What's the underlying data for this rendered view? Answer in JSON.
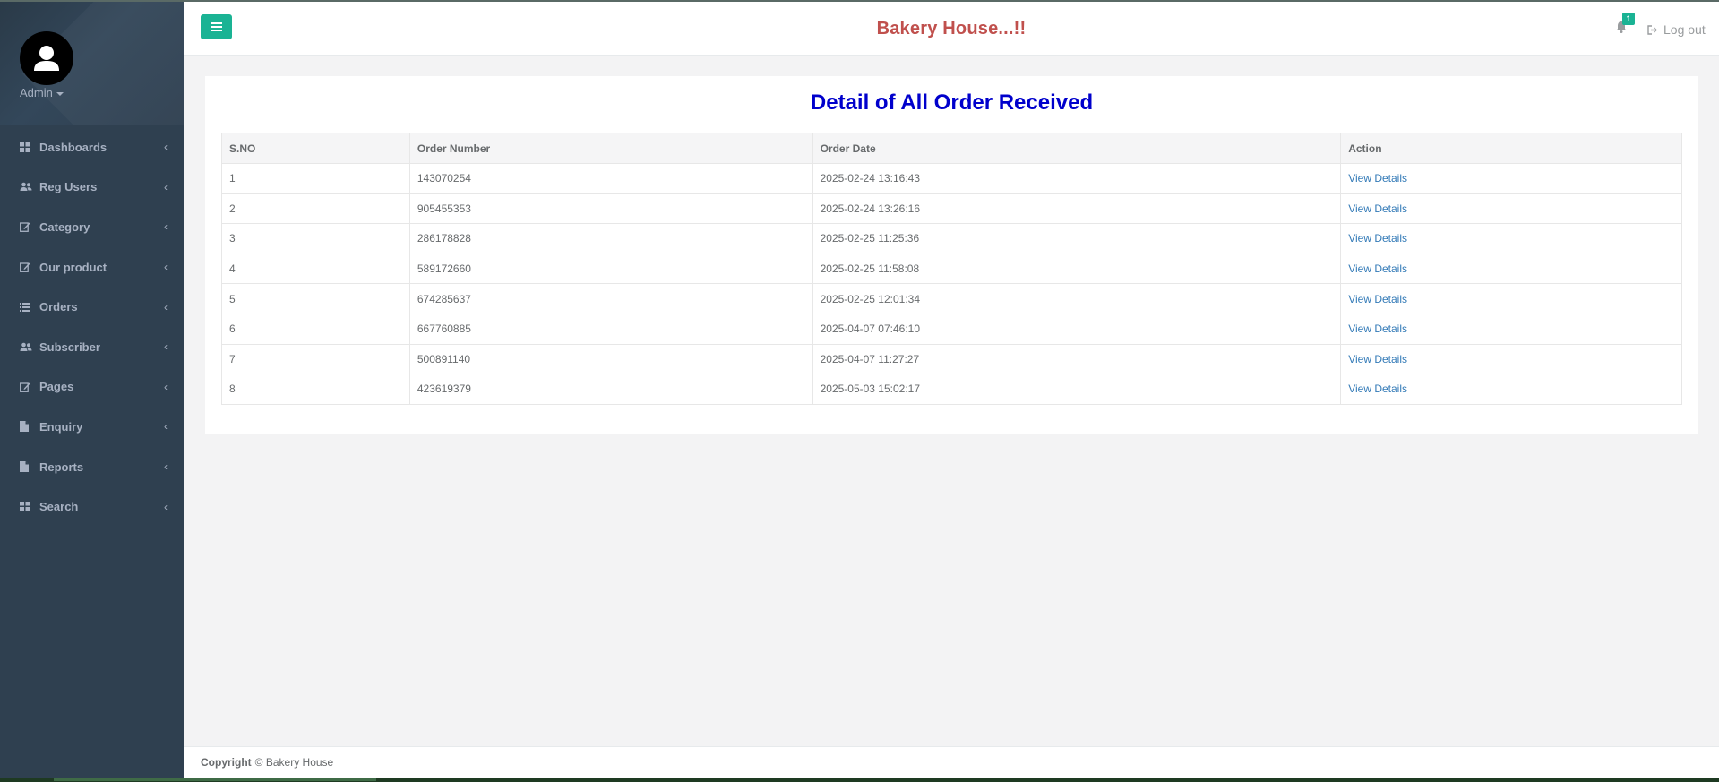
{
  "sidebar": {
    "profile": {
      "name": "Admin"
    },
    "items": [
      {
        "label": "Dashboards",
        "icon": "th-large-icon"
      },
      {
        "label": "Reg Users",
        "icon": "users-icon"
      },
      {
        "label": "Category",
        "icon": "edit-icon"
      },
      {
        "label": "Our product",
        "icon": "edit-icon"
      },
      {
        "label": "Orders",
        "icon": "list-icon"
      },
      {
        "label": "Subscriber",
        "icon": "users-icon"
      },
      {
        "label": "Pages",
        "icon": "edit-icon"
      },
      {
        "label": "Enquiry",
        "icon": "file-icon"
      },
      {
        "label": "Reports",
        "icon": "file-icon"
      },
      {
        "label": "Search",
        "icon": "th-large-icon"
      }
    ]
  },
  "header": {
    "brand": "Bakery House...!!",
    "notification_count": "1",
    "logout_label": "Log out"
  },
  "main": {
    "title": "Detail of All Order Received",
    "columns": [
      "S.NO",
      "Order Number",
      "Order Date",
      "Action"
    ],
    "rows": [
      {
        "sno": "1",
        "order_number": "143070254",
        "order_date": "2025-02-24 13:16:43",
        "action": "View Details"
      },
      {
        "sno": "2",
        "order_number": "905455353",
        "order_date": "2025-02-24 13:26:16",
        "action": "View Details"
      },
      {
        "sno": "3",
        "order_number": "286178828",
        "order_date": "2025-02-25 11:25:36",
        "action": "View Details"
      },
      {
        "sno": "4",
        "order_number": "589172660",
        "order_date": "2025-02-25 11:58:08",
        "action": "View Details"
      },
      {
        "sno": "5",
        "order_number": "674285637",
        "order_date": "2025-02-25 12:01:34",
        "action": "View Details"
      },
      {
        "sno": "6",
        "order_number": "667760885",
        "order_date": "2025-04-07 07:46:10",
        "action": "View Details"
      },
      {
        "sno": "7",
        "order_number": "500891140",
        "order_date": "2025-04-07 11:27:27",
        "action": "View Details"
      },
      {
        "sno": "8",
        "order_number": "423619379",
        "order_date": "2025-05-03 15:02:17",
        "action": "View Details"
      }
    ]
  },
  "footer": {
    "copyright_label": "Copyright",
    "copyright_text": "© Bakery House"
  },
  "colors": {
    "sidebar_bg": "#2f4050",
    "accent": "#1ab394",
    "brand": "#c0504d",
    "title": "#0000cc",
    "link": "#337ab7"
  }
}
